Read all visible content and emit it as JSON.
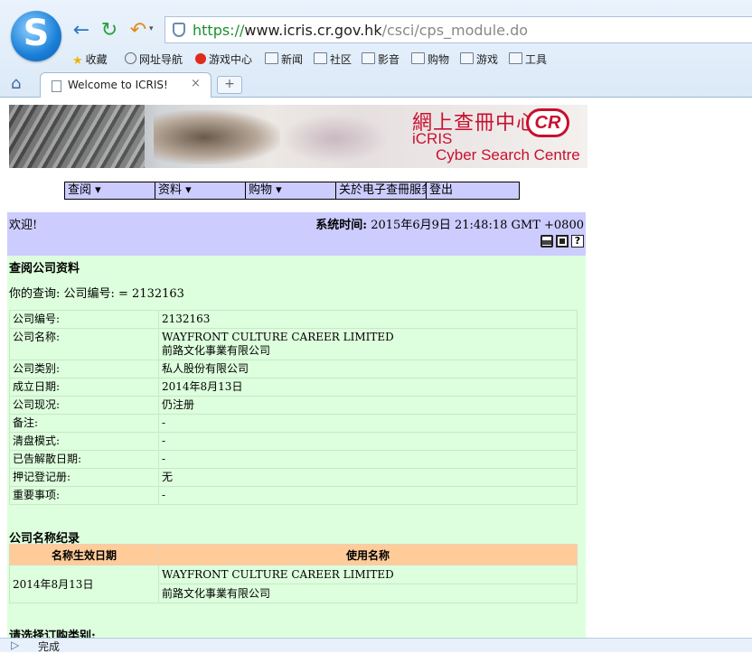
{
  "browser": {
    "logo_glyph": "S",
    "address": {
      "scheme": "https://",
      "domain": "www.icris.cr.gov.hk",
      "path": "/csci/cps_module.do"
    },
    "bookmarks": [
      {
        "label": "收藏",
        "icon": "star-icon"
      },
      {
        "label": "网址导航",
        "icon": "globe-icon"
      },
      {
        "label": "游戏中心",
        "icon": "game-icon"
      },
      {
        "label": "新闻",
        "icon": "folder-icon"
      },
      {
        "label": "社区",
        "icon": "folder-icon"
      },
      {
        "label": "影音",
        "icon": "folder-icon"
      },
      {
        "label": "购物",
        "icon": "folder-icon"
      },
      {
        "label": "游戏",
        "icon": "folder-icon"
      },
      {
        "label": "工具",
        "icon": "folder-icon"
      }
    ],
    "tab_title": "Welcome to ICRIS!",
    "tab_close": "×",
    "new_tab": "+",
    "status": "完成"
  },
  "banner": {
    "chinese_title": "網上查冊中心",
    "icris": "iCRIS",
    "subtitle": "Cyber Search Centre",
    "logo_text": "CR"
  },
  "menu": [
    "查阅 ▾",
    "资料 ▾",
    "购物 ▾",
    "关於电子查冊服务",
    "登出"
  ],
  "welcome": {
    "text": "欢迎!",
    "time_label": "系统时间:",
    "time_value": "2015年6月9日 21:48:18 GMT +0800"
  },
  "section_title": "查阅公司资料",
  "query_text": "你的查询: 公司编号: = 2132163",
  "company_info": [
    {
      "key": "公司编号:",
      "value": "2132163"
    },
    {
      "key": "公司名称:",
      "value": "WAYFRONT CULTURE CAREER LIMITED",
      "value2": "前路文化事業有限公司"
    },
    {
      "key": "公司类别:",
      "value": "私人股份有限公司"
    },
    {
      "key": "成立日期:",
      "value": "2014年8月13日"
    },
    {
      "key": "公司现况:",
      "value": "仍注册"
    },
    {
      "key": "备注:",
      "value": "-"
    },
    {
      "key": "清盘模式:",
      "value": "-"
    },
    {
      "key": "已告解散日期:",
      "value": "-"
    },
    {
      "key": "押记登记册:",
      "value": "无"
    },
    {
      "key": "重要事项:",
      "value": "-"
    }
  ],
  "name_history": {
    "title": "公司名称纪录",
    "headers": [
      "名称生效日期",
      "使用名称"
    ],
    "date": "2014年8月13日",
    "names": [
      "WAYFRONT CULTURE CAREER LIMITED",
      "前路文化事業有限公司"
    ]
  },
  "order_prompt": "请选择订购类别:"
}
